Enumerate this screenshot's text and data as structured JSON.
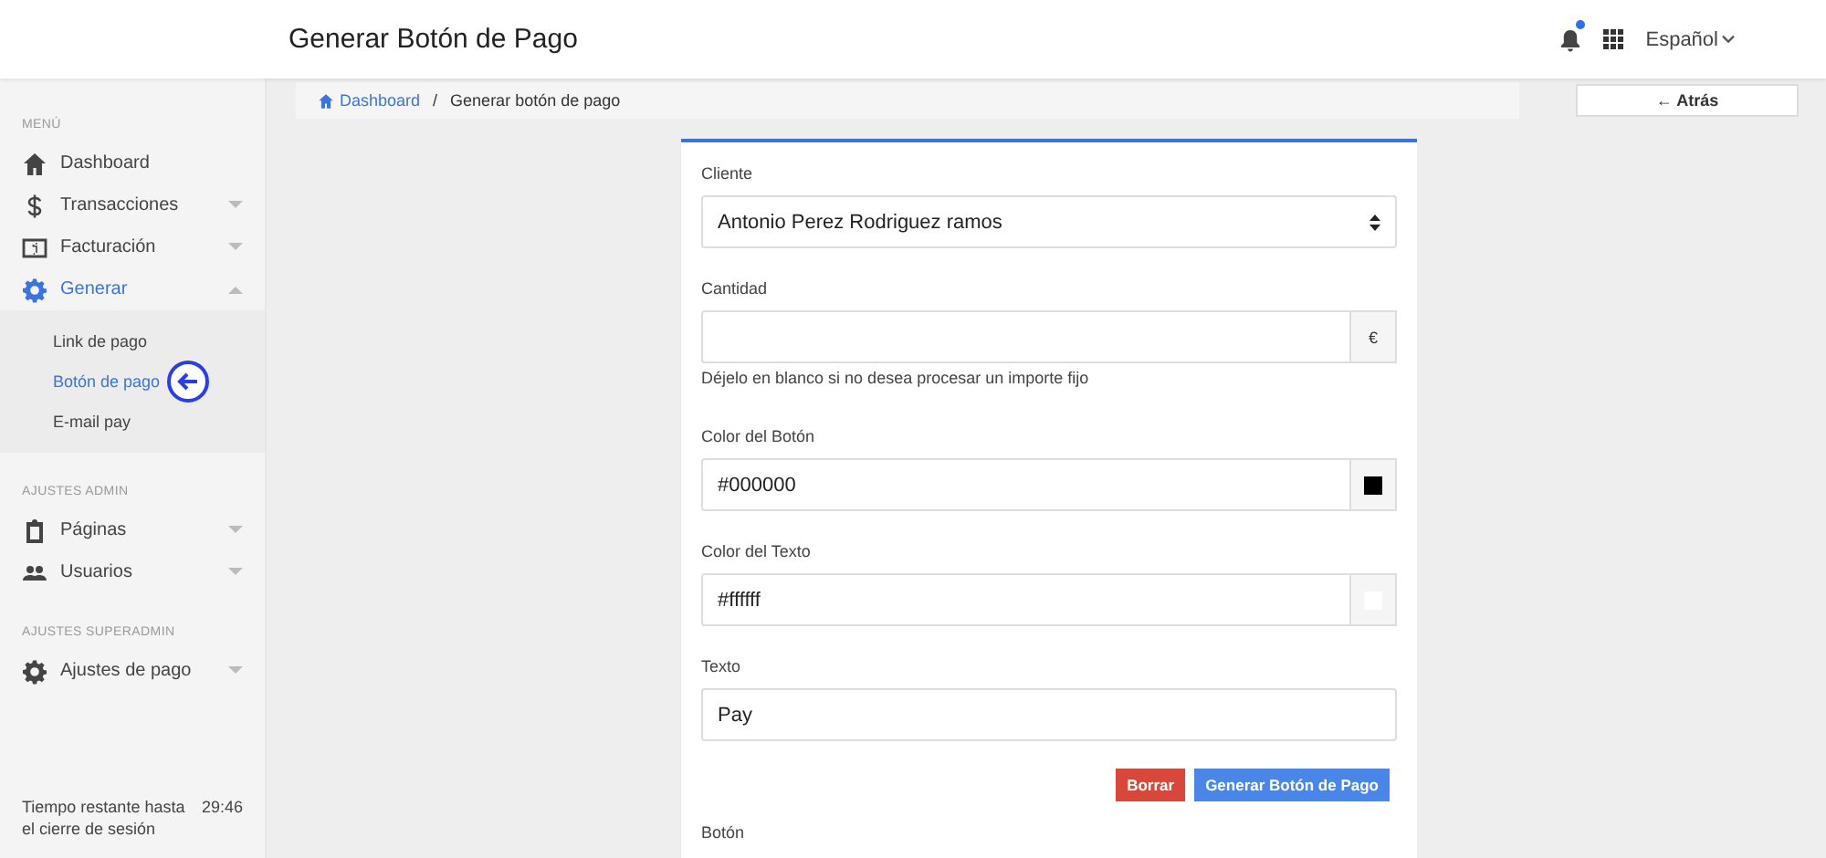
{
  "header": {
    "title": "Generar Botón de Pago",
    "notification_dot": true,
    "language": "Español"
  },
  "sidebar": {
    "sections": [
      {
        "heading": "MENÚ",
        "items": [
          {
            "label": "Dashboard",
            "kind": "link",
            "selected": false
          },
          {
            "label": "Transacciones",
            "kind": "group",
            "selected": false,
            "expanded": false
          },
          {
            "label": "Facturación",
            "kind": "group",
            "selected": false,
            "expanded": false
          },
          {
            "label": "Generar",
            "kind": "group",
            "selected": true,
            "expanded": true,
            "children": [
              {
                "label": "Link de pago",
                "selected": false
              },
              {
                "label": "Botón de pago",
                "selected": true
              },
              {
                "label": "E-mail pay",
                "selected": false
              }
            ]
          }
        ]
      },
      {
        "heading": "AJUSTES ADMIN",
        "items": [
          {
            "label": "Páginas",
            "kind": "group",
            "selected": false,
            "expanded": false
          },
          {
            "label": "Usuarios",
            "kind": "group",
            "selected": false,
            "expanded": false
          }
        ]
      },
      {
        "heading": "AJUSTES SUPERADMIN",
        "items": [
          {
            "label": "Ajustes de pago",
            "kind": "group",
            "selected": false,
            "expanded": false
          }
        ]
      }
    ],
    "session": {
      "label": "Tiempo restante hasta el cierre de sesión",
      "time": "29:46"
    }
  },
  "breadcrumb": {
    "separator": "/",
    "items": [
      {
        "label": "Dashboard",
        "kind": "link"
      },
      {
        "label": "Generar botón de pago",
        "kind": "current"
      }
    ]
  },
  "back_button": {
    "label": "← Atrás"
  },
  "form": {
    "fields": [
      {
        "label": "Cliente",
        "kind": "select",
        "value": "Antonio Perez Rodriguez ramos"
      },
      {
        "label": "Cantidad",
        "kind": "addon",
        "addon": "€",
        "help": "Déjelo en blanco si no desea procesar un importe fijo"
      },
      {
        "label": "Color del Botón",
        "kind": "color",
        "value": "#000000",
        "color": "#000000"
      },
      {
        "label": "Color del Texto",
        "kind": "color",
        "value": "#ffffff",
        "color": "#ffffff"
      },
      {
        "label": "Texto",
        "kind": "text",
        "value": "Pay"
      }
    ],
    "buttons": [
      {
        "label": "Borrar",
        "kind": "danger"
      },
      {
        "label": "Generar Botón de Pago",
        "kind": "primary"
      }
    ],
    "next_label": "Botón"
  }
}
